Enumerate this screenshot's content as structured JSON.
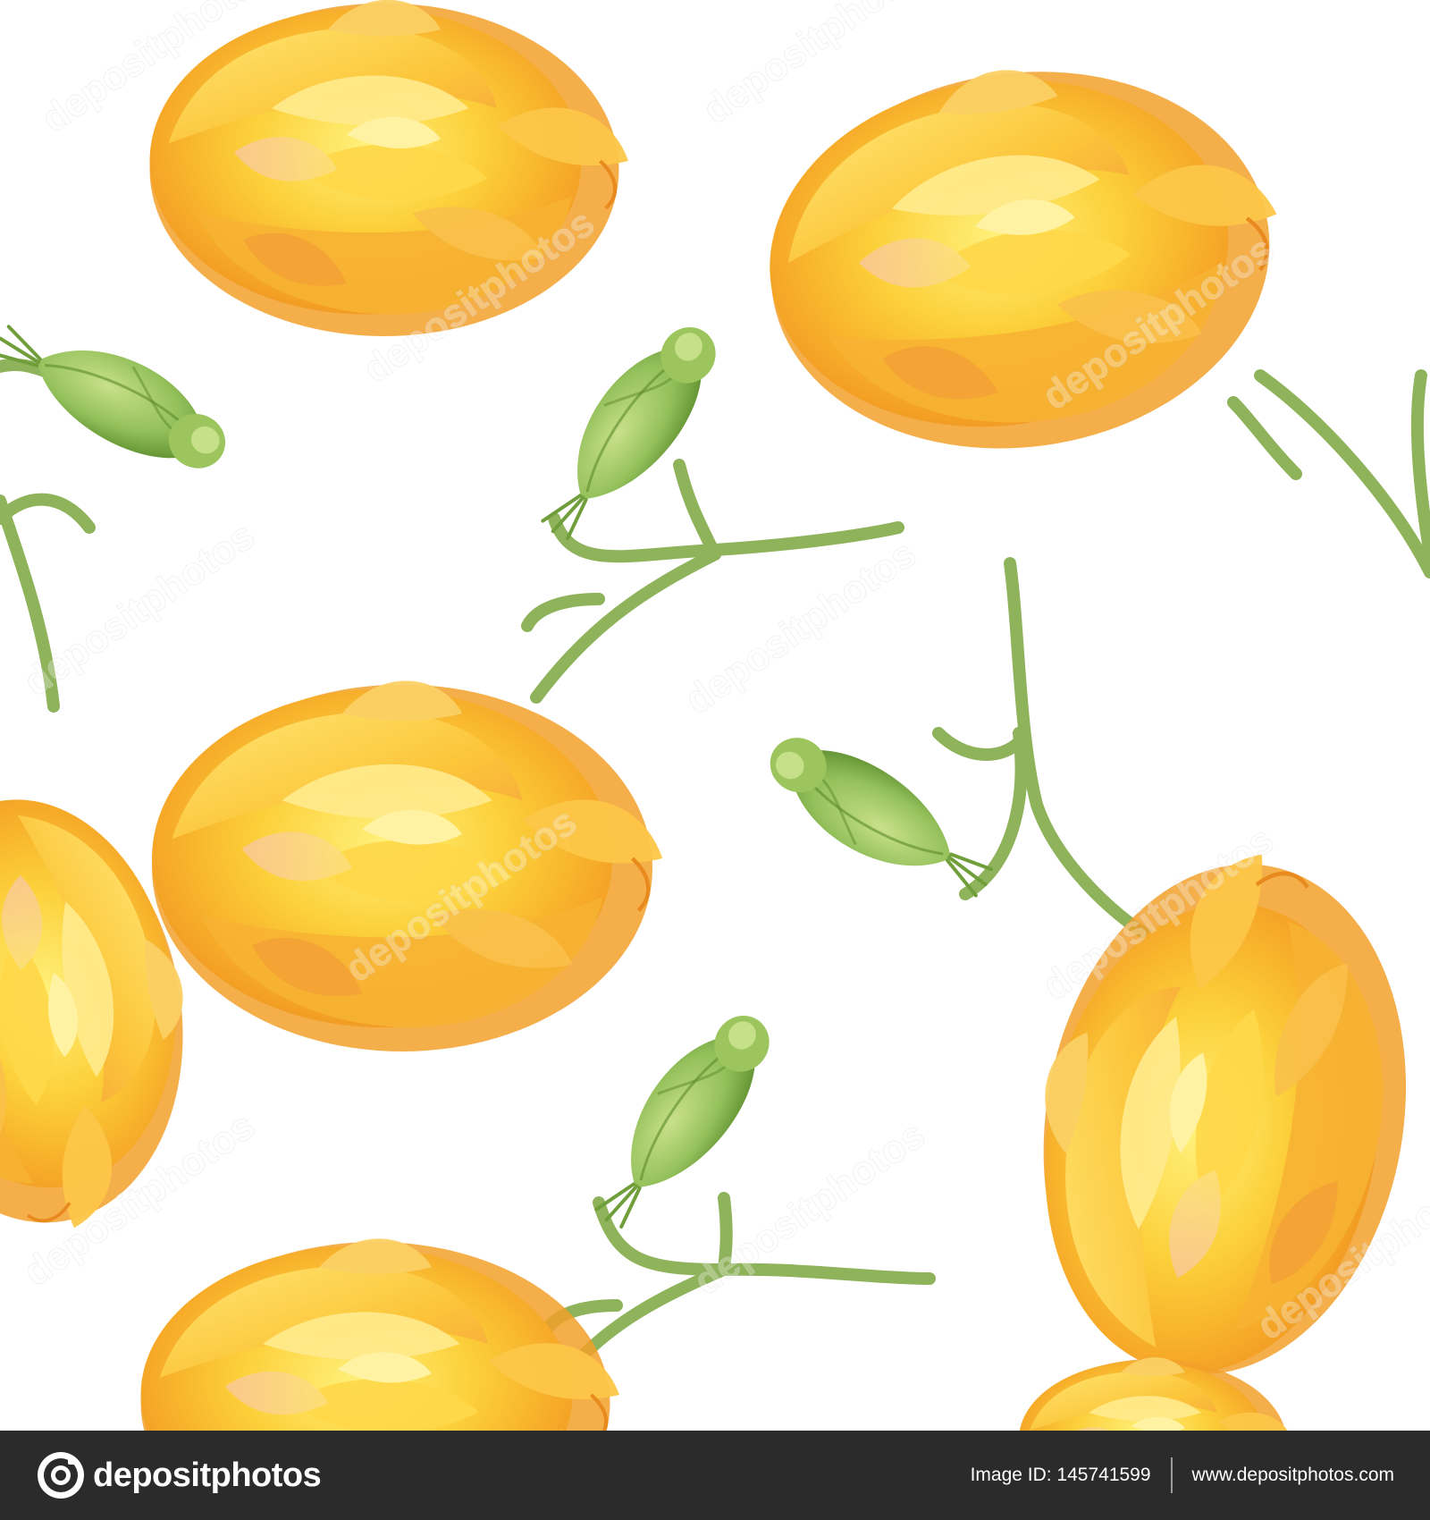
{
  "artwork": {
    "subject": "seamless pattern of yellow watercolor roses with green buds and stems",
    "watermark_text": "depositphotos",
    "colors": {
      "background": "#ffffff",
      "petal_light": "#ffe066",
      "petal_mid": "#fbc02d",
      "petal_dark": "#f29a1b",
      "petal_blush": "#f7b88a",
      "leaf_light": "#a9cf6a",
      "leaf_dark": "#6f9e3a",
      "stem": "#8fb35a"
    }
  },
  "footer": {
    "brand_name": "depositphotos",
    "image_id": "Image ID: 145741599",
    "site_url": "www.depositphotos.com",
    "colors": {
      "background": "#2b2b2b",
      "text": "#ffffff"
    }
  }
}
